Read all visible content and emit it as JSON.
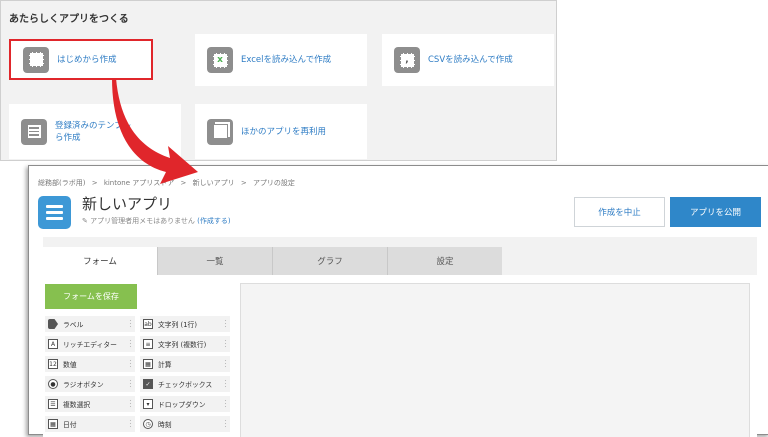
{
  "create_panel": {
    "title": "あたらしくアプリをつくる",
    "options": [
      {
        "label": "はじめから作成"
      },
      {
        "label": "Excelを読み込んで作成"
      },
      {
        "label": "CSVを読み込んで作成"
      },
      {
        "label_lines": [
          "登録済みのテンプレ",
          "ら作成"
        ]
      },
      {
        "label": "ほかのアプリを再利用"
      }
    ]
  },
  "breadcrumb": [
    "総務部(ラボ用)",
    ">",
    "kintone アプリストア",
    ">",
    "新しいアプリ",
    ">",
    "アプリの設定"
  ],
  "app": {
    "title": "新しいアプリ",
    "memo": "アプリ管理者用メモはありません",
    "memo_edit": "(作成する)"
  },
  "buttons": {
    "cancel": "作成を中止",
    "publish": "アプリを公開",
    "save_form": "フォームを保存"
  },
  "tabs": [
    {
      "label": "フォーム",
      "active": true
    },
    {
      "label": "一覧",
      "active": false
    },
    {
      "label": "グラフ",
      "active": false
    },
    {
      "label": "設定",
      "active": false
    }
  ],
  "fields": [
    {
      "label": "ラベル",
      "icon": "tag-icon"
    },
    {
      "label": "文字列 (1行)",
      "icon": "single-line-text-icon"
    },
    {
      "label": "リッチエディター",
      "icon": "rich-text-icon"
    },
    {
      "label": "文字列 (複数行)",
      "icon": "multi-line-text-icon"
    },
    {
      "label": "数値",
      "icon": "number-icon"
    },
    {
      "label": "計算",
      "icon": "calculator-icon"
    },
    {
      "label": "ラジオボタン",
      "icon": "radio-icon"
    },
    {
      "label": "チェックボックス",
      "icon": "checkbox-icon"
    },
    {
      "label": "複数選択",
      "icon": "multi-select-icon"
    },
    {
      "label": "ドロップダウン",
      "icon": "dropdown-icon"
    },
    {
      "label": "日付",
      "icon": "calendar-icon"
    },
    {
      "label": "時刻",
      "icon": "clock-icon"
    }
  ],
  "colors": {
    "link_blue": "#2e7cc4",
    "publish_blue": "#2f87c9",
    "save_green": "#86c04f",
    "highlight_red": "#e0262b"
  }
}
